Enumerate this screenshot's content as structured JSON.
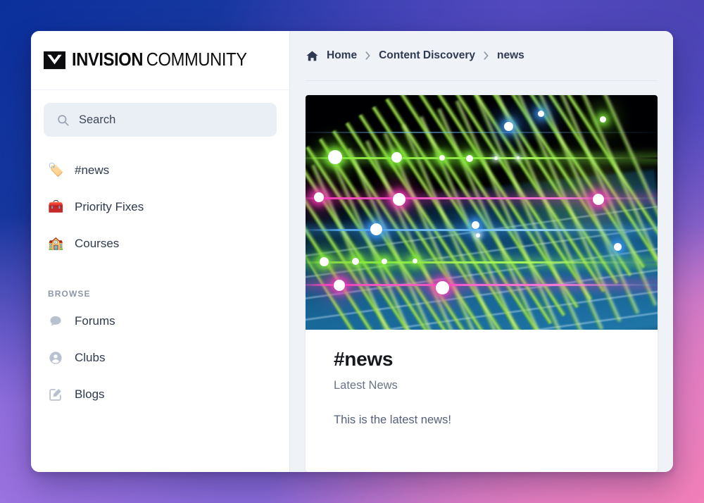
{
  "window": {
    "brand": {
      "mark_icon": "invision-triangle-mark-icon",
      "name_bold": "INVISION",
      "name_regular": "COMMUNITY"
    }
  },
  "sidebar": {
    "search": {
      "icon": "search-icon",
      "placeholder": "Search",
      "value": ""
    },
    "pinned_items": [
      {
        "icon": "label-tag-emoji",
        "emoji": "🏷️",
        "label": "#news"
      },
      {
        "icon": "toolbox-emoji",
        "emoji": "🧰",
        "label": "Priority Fixes"
      },
      {
        "icon": "school-building-emoji",
        "emoji": "🏫",
        "label": "Courses"
      }
    ],
    "browse": {
      "heading": "BROWSE",
      "items": [
        {
          "icon": "comment-bubble-icon",
          "label": "Forums"
        },
        {
          "icon": "user-circle-icon",
          "label": "Clubs"
        },
        {
          "icon": "pencil-square-icon",
          "label": "Blogs"
        }
      ]
    }
  },
  "main": {
    "breadcrumb": {
      "home_icon": "home-icon",
      "separator_icon": "chevron-right-icon",
      "items": [
        {
          "label": "Home"
        },
        {
          "label": "Content Discovery"
        },
        {
          "label": "news"
        }
      ]
    },
    "news_card": {
      "hero_image_alt": "abstract glowing green blue and pink light streaks",
      "title": "#news",
      "subtitle": "Latest News",
      "body": "This is the latest news!"
    }
  },
  "theme": {
    "background_top_left": "#0b2f9c",
    "background_top_right": "#4b44b5",
    "background_bottom_left": "#9b72e0",
    "background_bottom_right": "#f17fb8",
    "panel_background": "#eff2f7",
    "card_background": "#ffffff",
    "search_background": "#eaeef5",
    "text_primary": "#2e3a52",
    "text_muted": "#6a7487",
    "icon_muted": "#b9c1cf"
  }
}
